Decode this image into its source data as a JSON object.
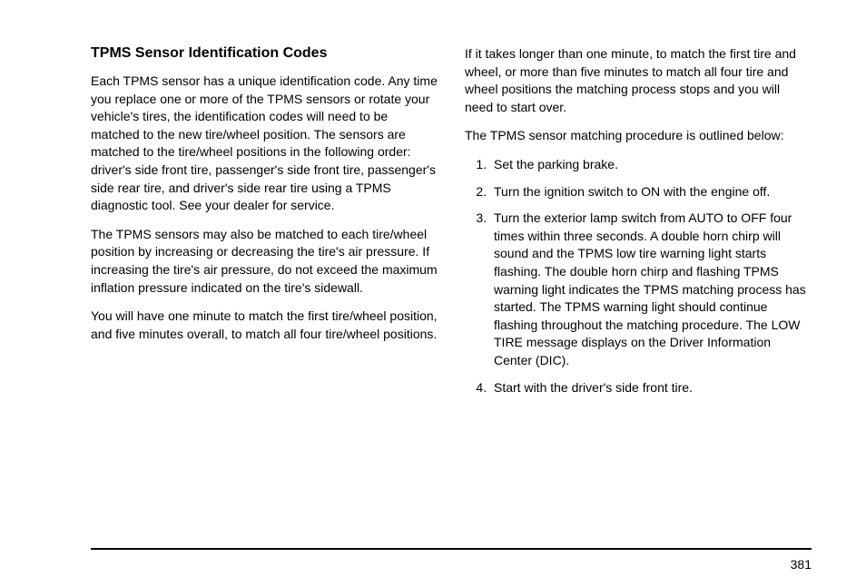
{
  "heading": "TPMS Sensor Identification Codes",
  "left_paragraphs": [
    "Each TPMS sensor has a unique identification code. Any time you replace one or more of the TPMS sensors or rotate your vehicle's tires, the identification codes will need to be matched to the new tire/wheel position. The sensors are matched to the tire/wheel positions in the following order: driver's side front tire, passenger's side front tire, passenger's side rear tire, and driver's side rear tire using a TPMS diagnostic tool. See your dealer for service.",
    "The TPMS sensors may also be matched to each tire/wheel position by increasing or decreasing the tire's air pressure. If increasing the tire's air pressure, do not exceed the maximum inflation pressure indicated on the tire's sidewall.",
    "You will have one minute to match the first tire/wheel position, and five minutes overall, to match all four tire/wheel positions."
  ],
  "right_paragraphs": [
    "If it takes longer than one minute, to match the first tire and wheel, or more than five minutes to match all four tire and wheel positions the matching process stops and you will need to start over.",
    "The TPMS sensor matching procedure is outlined below:"
  ],
  "steps": [
    "Set the parking brake.",
    "Turn the ignition switch to ON with the engine off.",
    "Turn the exterior lamp switch from AUTO to OFF four times within three seconds. A double horn chirp will sound and the TPMS low tire warning light starts flashing. The double horn chirp and flashing TPMS warning light indicates the TPMS matching process has started. The TPMS warning light should continue flashing throughout the matching procedure. The LOW TIRE message displays on the Driver Information Center (DIC).",
    "Start with the driver's side front tire."
  ],
  "page_number": "381"
}
